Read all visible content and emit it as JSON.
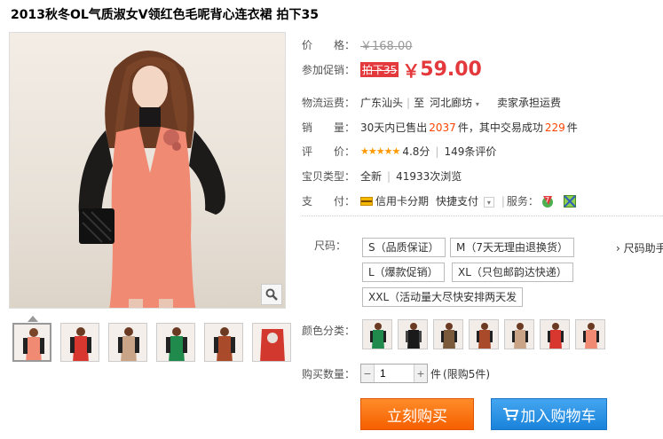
{
  "product": {
    "title": "2013秋冬OL气质淑女V领红色毛呢背心连衣裙 拍下35"
  },
  "price": {
    "label": "价　　格：",
    "original": "￥168.00"
  },
  "promo": {
    "label": "参加促销：",
    "tag": "拍下35",
    "currency": "￥",
    "value": "59.00"
  },
  "shipping": {
    "label": "物流运费：",
    "from": "广东汕头",
    "to_word": "至",
    "to": "河北廊坊",
    "note": "卖家承担运费"
  },
  "sales": {
    "label": "销　　量：",
    "prefix": "30天内已售出",
    "sold": "2037",
    "mid": "件，其中交易成功",
    "success": "229",
    "suffix": "件"
  },
  "rating": {
    "label": "评　　价：",
    "stars": "★★★★★",
    "score": "4.8分",
    "reviews": "149条评价"
  },
  "item_type": {
    "label": "宝贝类型：",
    "condition": "全新",
    "views": "41933次浏览"
  },
  "payment": {
    "label": "支　　付：",
    "credit": "信用卡分期",
    "quick": "快捷支付",
    "service_label": "服务："
  },
  "size": {
    "label": "尺码：",
    "options": [
      "S（品质保证）",
      "M（7天无理由退换货）",
      "L（爆款促销）",
      "XL（只包邮韵达快递）",
      "XXL（活动量大尽快安排两天发"
    ],
    "help": "› 尺码助手"
  },
  "color": {
    "label": "颜色分类："
  },
  "quantity": {
    "label": "购买数量：",
    "value": "1",
    "unit": "件",
    "limit": "(限购5件)"
  },
  "actions": {
    "buy_now": "立刻购买",
    "add_to_cart": "加入购物车"
  },
  "colors": {
    "accent_red": "#e4393c",
    "orange": "#f55f00",
    "blue": "#1a83da",
    "dress_coral": "#f08a72"
  }
}
